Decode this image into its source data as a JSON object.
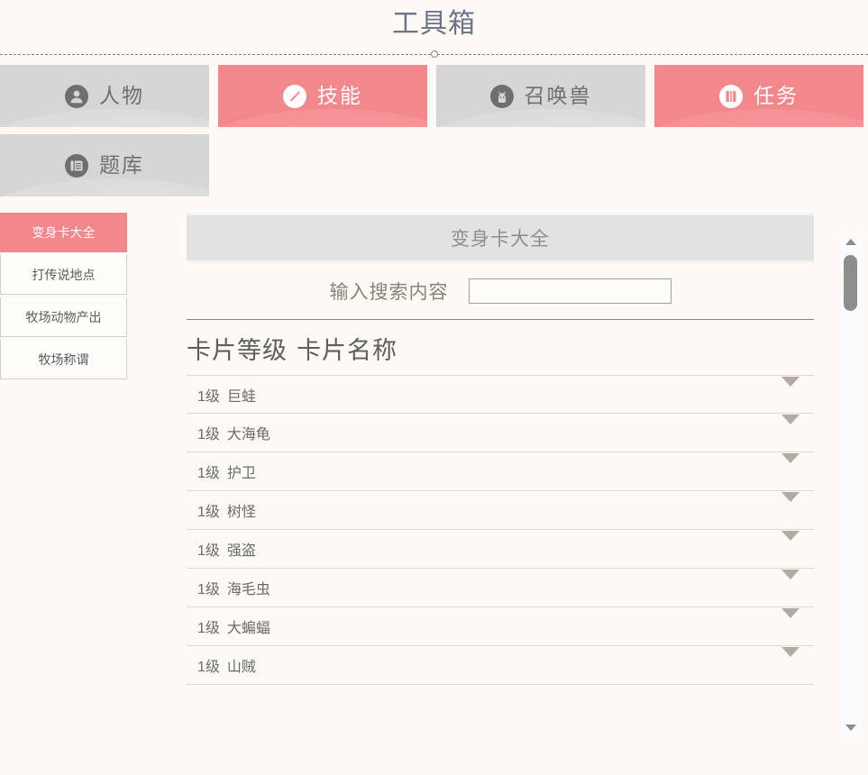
{
  "page": {
    "title": "工具箱",
    "background_color": "#fdfaf5",
    "accent_color": "#f2888c",
    "title_color": "#6d7486"
  },
  "tabs": [
    {
      "label": "人物",
      "icon": "person-icon",
      "state": "inactive"
    },
    {
      "label": "技能",
      "icon": "skill-icon",
      "state": "active"
    },
    {
      "label": "召唤兽",
      "icon": "pet-icon",
      "state": "inactive"
    },
    {
      "label": "任务",
      "icon": "quest-icon",
      "state": "active"
    },
    {
      "label": "题库",
      "icon": "quiz-icon",
      "state": "inactive"
    }
  ],
  "sidebar": {
    "items": [
      {
        "label": "变身卡大全",
        "state": "active"
      },
      {
        "label": "打传说地点",
        "state": "inactive"
      },
      {
        "label": "牧场动物产出",
        "state": "inactive"
      },
      {
        "label": "牧场称谓",
        "state": "inactive"
      }
    ]
  },
  "panel": {
    "title": "变身卡大全",
    "search": {
      "label": "输入搜索内容",
      "value": "",
      "placeholder": ""
    },
    "table": {
      "columns": [
        "卡片等级",
        "卡片名称"
      ],
      "rows": [
        {
          "level": "1级",
          "name": "巨蛙"
        },
        {
          "level": "1级",
          "name": "大海龟"
        },
        {
          "level": "1级",
          "name": "护卫"
        },
        {
          "level": "1级",
          "name": "树怪"
        },
        {
          "level": "1级",
          "name": "强盗"
        },
        {
          "level": "1级",
          "name": "海毛虫"
        },
        {
          "level": "1级",
          "name": "大蝙蝠"
        },
        {
          "level": "1级",
          "name": "山贼"
        }
      ]
    }
  },
  "scrollbar": {
    "up_label": "▲",
    "down_label": "▼"
  }
}
